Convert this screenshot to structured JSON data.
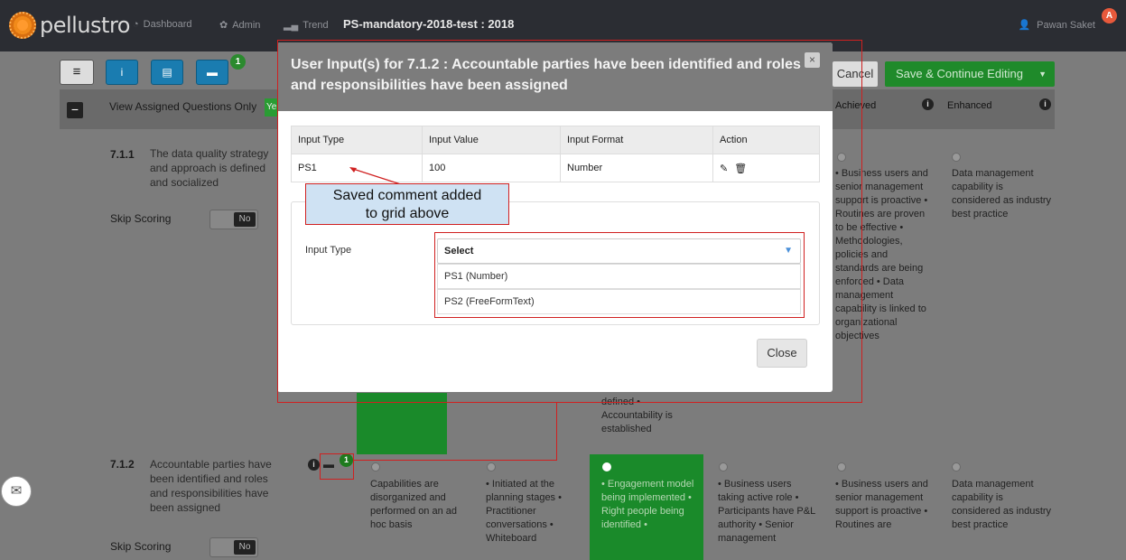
{
  "nav": {
    "brand": "pellustro",
    "dashboard": "Dashboard",
    "admin": "Admin",
    "trend": "Trend",
    "title": "PS-mandatory-2018-test : 2018",
    "user": "Pawan Saket",
    "user_badge": "A"
  },
  "toolbar": {
    "menu_icon": "≡",
    "info_icon": "i",
    "list_icon": "▤",
    "comment_icon": "▬",
    "comment_badge": "1",
    "cancel": "Cancel",
    "save": "Save & Continue Editing",
    "save_caret": "▼"
  },
  "header": {
    "collapse": "−",
    "view_assigned": "View Assigned Questions Only",
    "toggle_yes": "Ye",
    "achieved": "Achieved",
    "enhanced": "Enhanced",
    "info": "i"
  },
  "row1": {
    "num": "7.1.1",
    "desc": "The data quality strategy and approach is defined and socialized",
    "skip": "Skip Scoring",
    "skip_value": "No",
    "achieved": "• Business users and senior management support is proactive • Routines are proven to be effective • Methodologies, policies and standards are being enforced • Data management capability is linked to organizational objectives",
    "enhanced": "Data management capability is considered as industry best practice",
    "partial": "defined • Accountability is established"
  },
  "row2": {
    "num": "7.1.2",
    "desc": "Accountable parties have been identified and roles and responsibilities have been assigned",
    "skip": "Skip Scoring",
    "skip_value": "No",
    "comment_count": "1",
    "col1": "Capabilities are disorganized and performed on an ad hoc basis",
    "col2": "• Initiated at the planning stages • Practitioner conversations • Whiteboard",
    "col3": "• Engagement model being implemented • Right people being identified •",
    "col4": "• Business users taking active role • Participants have P&L authority • Senior management",
    "col5": "• Business users and senior management support is proactive • Routines are",
    "col6": "Data management capability is considered as industry best practice"
  },
  "modal": {
    "title": "User Input(s) for 7.1.2 : Accountable parties have been identified and roles and responsibilities have been assigned",
    "close_x": "×",
    "columns": [
      "Input Type",
      "Input Value",
      "Input Format",
      "Action"
    ],
    "rows": [
      {
        "type": "PS1",
        "value": "100",
        "format": "Number"
      }
    ],
    "edit_icon": "✎",
    "delete_icon": "🗑",
    "input_type_label": "Input Type",
    "select_placeholder": "Select",
    "select_arrow": "▼",
    "options": [
      "PS1 (Number)",
      "PS2 (FreeFormText)"
    ],
    "close_button": "Close"
  },
  "callout": {
    "line1": "Saved comment added",
    "line2": "to grid above"
  },
  "side_button_icon": "✉"
}
